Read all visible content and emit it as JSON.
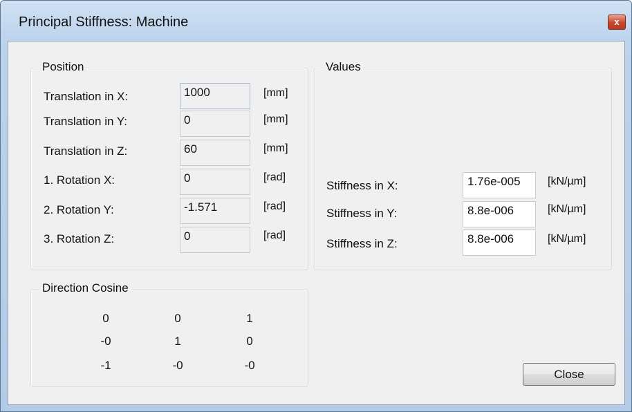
{
  "window": {
    "title": "Principal Stiffness: Machine",
    "close_glyph": "x"
  },
  "position": {
    "title": "Position",
    "rows": [
      {
        "label": "Translation in X:",
        "value": "1000",
        "unit": "[mm]"
      },
      {
        "label": "Translation in Y:",
        "value": "0",
        "unit": "[mm]"
      },
      {
        "label": "Translation in Z:",
        "value": "60",
        "unit": "[mm]"
      },
      {
        "label": "1. Rotation  X:",
        "value": "0",
        "unit": "[rad]"
      },
      {
        "label": "2. Rotation  Y:",
        "value": "-1.571",
        "unit": "[rad]"
      },
      {
        "label": "3. Rotation  Z:",
        "value": "0",
        "unit": "[rad]"
      }
    ]
  },
  "values": {
    "title": "Values",
    "rows": [
      {
        "label": "Stiffness in X:",
        "value": "1.76e-005",
        "unit": "[kN/µm]"
      },
      {
        "label": "Stiffness in Y:",
        "value": "8.8e-006",
        "unit": "[kN/µm]"
      },
      {
        "label": "Stiffness in Z:",
        "value": "8.8e-006",
        "unit": "[kN/µm]"
      }
    ]
  },
  "direction_cosine": {
    "title": "Direction Cosine",
    "matrix": [
      [
        "0",
        "0",
        "1"
      ],
      [
        "-0",
        "1",
        "0"
      ],
      [
        "-1",
        "-0",
        "-0"
      ]
    ]
  },
  "buttons": {
    "close_label": "Close"
  }
}
